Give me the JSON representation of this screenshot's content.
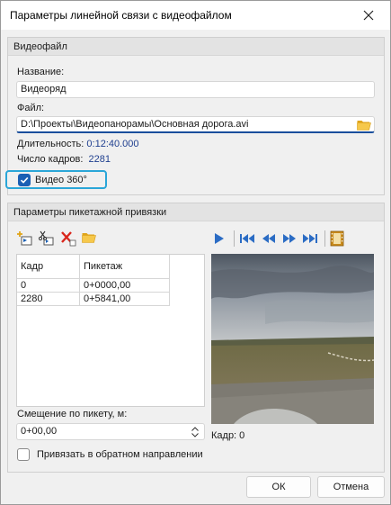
{
  "window": {
    "title": "Параметры линейной связи с видеофайлом"
  },
  "video_file": {
    "group_title": "Видеофайл",
    "name_label": "Название:",
    "name_value": "Видеоряд",
    "file_label": "Файл:",
    "file_value": "D:\\Проекты\\Видеопанорамы\\Основная дорога.avi",
    "duration_label": "Длительность:",
    "duration_value": "0:12:40.000",
    "frames_label": "Число кадров:",
    "frames_value": "2281",
    "video360_label": "Видео 360°",
    "video360_checked": true
  },
  "picket": {
    "group_title": "Параметры пикетажной привязки",
    "table": {
      "columns": [
        "Кадр",
        "Пикетаж"
      ],
      "rows": [
        [
          "0",
          "0+0000,00"
        ],
        [
          "2280",
          "0+5841,00"
        ]
      ]
    },
    "offset_label": "Смещение по пикету, м:",
    "offset_value": "0+00,00",
    "frame_label": "Кадр: 0",
    "reverse_label": "Привязать в обратном направлении",
    "reverse_checked": false
  },
  "buttons": {
    "ok": "ОК",
    "cancel": "Отмена"
  },
  "colors": {
    "accent": "#1a5fb4",
    "focus": "#2aa6d8",
    "value_text": "#1f3f8f",
    "delete_red": "#d9261c"
  }
}
